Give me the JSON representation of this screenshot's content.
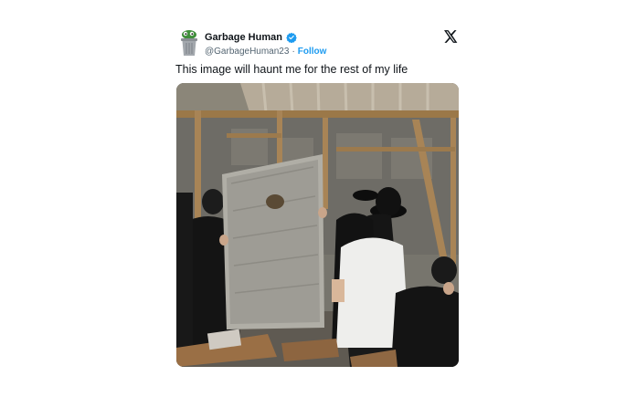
{
  "tweet": {
    "author": {
      "display_name": "Garbage Human",
      "handle": "@GarbageHuman23",
      "separator": "·",
      "follow_label": "Follow",
      "verified": true,
      "avatar_icon": "trash-can-avatar-icon"
    },
    "platform_icon": "x-logo-icon",
    "text": "This image will haunt me for the rest of my life",
    "colors": {
      "text_primary": "#0f1419",
      "text_secondary": "#536471",
      "link_blue": "#1d9bf0",
      "verified_blue": "#1d9bf0"
    }
  }
}
